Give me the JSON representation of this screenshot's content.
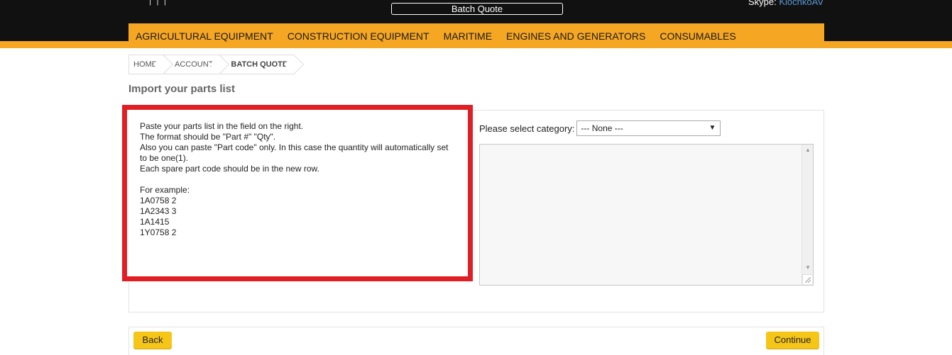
{
  "header": {
    "cut_links": "|   |   |",
    "batch_quote_label": "Batch Quote",
    "skype_label": "Skype:",
    "skype_user": "KlochkoAV"
  },
  "nav": {
    "items": [
      {
        "label": "AGRICULTURAL EQUIPMENT"
      },
      {
        "label": "CONSTRUCTION EQUIPMENT"
      },
      {
        "label": "MARITIME"
      },
      {
        "label": "ENGINES AND GENERATORS"
      },
      {
        "label": "CONSUMABLES"
      }
    ]
  },
  "breadcrumb": {
    "items": [
      {
        "label": "HOME"
      },
      {
        "label": "ACCOUNT"
      },
      {
        "label": "BATCH QUOTE"
      }
    ]
  },
  "page": {
    "title": "Import your parts list"
  },
  "instructions": {
    "text": "Paste your parts list in the field on the right.\nThe format should be \"Part #\" \"Qty\".\nAlso you can paste \"Part code\" only. In this case the quantity will automatically set to be one(1).\nEach spare part code should be in the new row.\n\nFor example:\n1A0758 2\n1A2343 3\n1A1415\n1Y0758 2"
  },
  "category": {
    "label": "Please select category:",
    "selected": "--- None ---"
  },
  "parts_input": {
    "value": ""
  },
  "buttons": {
    "back": "Back",
    "continue": "Continue"
  },
  "colors": {
    "accent": "#f5a623",
    "button": "#f5c518",
    "highlight": "#e01e24",
    "header_bg": "#111111"
  }
}
